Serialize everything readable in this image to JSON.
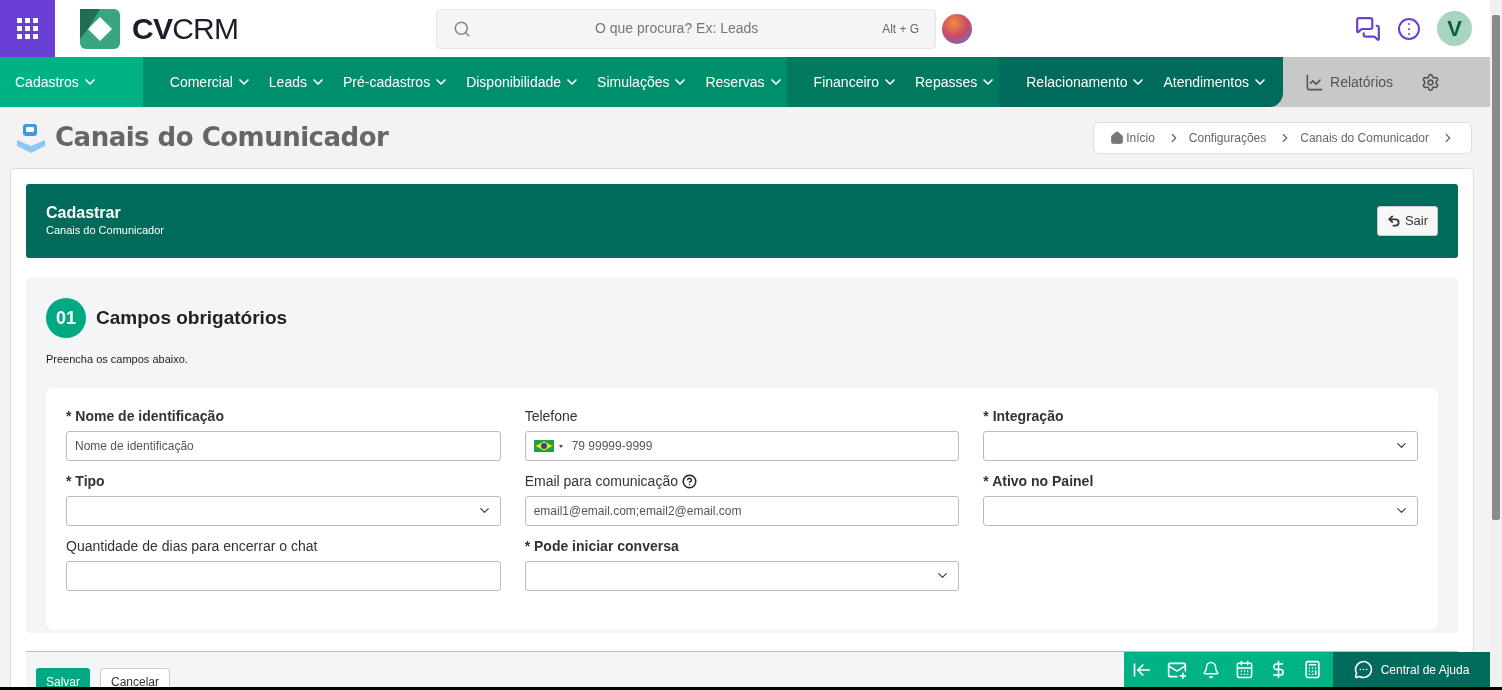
{
  "header": {
    "brand": {
      "bold": "CV",
      "light": "CRM"
    },
    "search": {
      "placeholder": "O que procura? Ex: Leads",
      "shortcut": "Alt + G"
    },
    "avatar": "V"
  },
  "nav": {
    "groups": [
      {
        "color": "#00b386",
        "items": [
          "Cadastros"
        ]
      },
      {
        "color": "#008f6c",
        "items": [
          "Comercial",
          "Leads",
          "Pré-cadastros",
          "Disponibilidade",
          "Simulações",
          "Reservas"
        ]
      },
      {
        "color": "#007a5e",
        "items": [
          "Financeiro",
          "Repasses"
        ]
      },
      {
        "color": "#006b5a",
        "items": [
          "Relacionamento",
          "Atendimentos"
        ]
      }
    ],
    "reports": "Relatórios"
  },
  "page": {
    "title": "Canais do Comunicador",
    "breadcrumb": [
      "Início",
      "Configurações",
      "Canais do Comunicador"
    ]
  },
  "banner": {
    "title": "Cadastrar",
    "subtitle": "Canais do Comunicador",
    "exit": "Sair"
  },
  "section": {
    "number": "01",
    "title": "Campos obrigatórios",
    "hint": "Preencha os campos abaixo.",
    "fields": [
      {
        "kind": "text",
        "label": "* Nome de identificação",
        "required": true,
        "placeholder": "Nome de identificação"
      },
      {
        "kind": "phone",
        "label": "Telefone",
        "required": false,
        "placeholder": "79 99999-9999"
      },
      {
        "kind": "select",
        "label": "* Integração",
        "required": true
      },
      {
        "kind": "select",
        "label": "* Tipo",
        "required": true
      },
      {
        "kind": "text",
        "label": "Email para comunicação",
        "required": false,
        "help": true,
        "placeholder": "email1@email.com;email2@email.com"
      },
      {
        "kind": "select",
        "label": "* Ativo no Painel",
        "required": true
      },
      {
        "kind": "text",
        "label": "Quantidade de dias para encerrar o chat",
        "required": false
      },
      {
        "kind": "select",
        "label": "* Pode iniciar conversa",
        "required": true
      }
    ]
  },
  "actions": [
    "Salvar",
    "Cancelar"
  ],
  "dock": {
    "help": "Central de Ajuda"
  }
}
